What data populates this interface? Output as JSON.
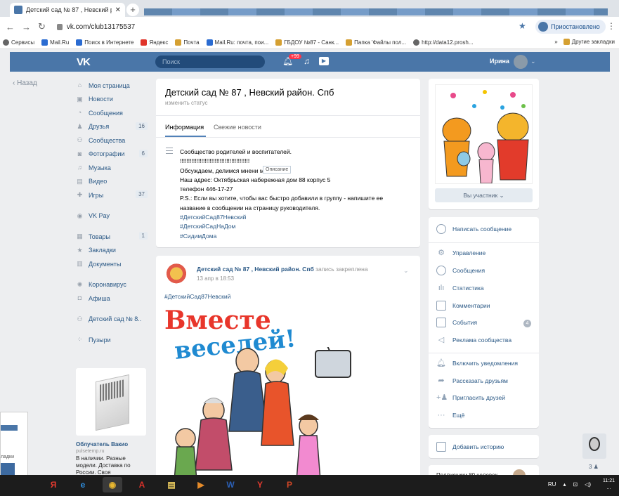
{
  "browser": {
    "tab_title": "Детский сад № 87 , Невский р",
    "url": "vk.com/club13175537",
    "profile_label": "Приостановлено",
    "bookmarks": [
      {
        "label": "Сервисы",
        "color": "grey"
      },
      {
        "label": "Mail.Ru",
        "color": "blue"
      },
      {
        "label": "Поиск в Интернете",
        "color": "blue"
      },
      {
        "label": "Яндекс",
        "color": "red"
      },
      {
        "label": "Почта",
        "color": "yellow"
      },
      {
        "label": "Mail.Ru: почта, пои...",
        "color": "blue"
      },
      {
        "label": "ГБДОУ №87 - Санк...",
        "color": "yellow"
      },
      {
        "label": "Папка 'Файлы пол...",
        "color": "yellow"
      },
      {
        "label": "http://data12.prosh...",
        "color": "grey"
      }
    ],
    "more_bookmarks": "»",
    "other_bookmarks": "Другие закладки"
  },
  "vk_header": {
    "logo": "VK",
    "search_placeholder": "Поиск",
    "notifications_badge": "+99",
    "user_name": "Ирина"
  },
  "back_label": "Назад",
  "sidebar": {
    "items": [
      {
        "label": "Моя страница",
        "icon": "home-icon",
        "glyph": "⌂",
        "count": ""
      },
      {
        "label": "Новости",
        "icon": "news-icon",
        "glyph": "▣",
        "count": ""
      },
      {
        "label": "Сообщения",
        "icon": "messages-icon",
        "glyph": "◔",
        "count": ""
      },
      {
        "label": "Друзья",
        "icon": "friends-icon",
        "glyph": "♟",
        "count": "16"
      },
      {
        "label": "Сообщества",
        "icon": "communities-icon",
        "glyph": "⚇",
        "count": ""
      },
      {
        "label": "Фотографии",
        "icon": "photos-icon",
        "glyph": "◙",
        "count": "6"
      },
      {
        "label": "Музыка",
        "icon": "music-icon",
        "glyph": "♫",
        "count": ""
      },
      {
        "label": "Видео",
        "icon": "video-icon",
        "glyph": "▤",
        "count": ""
      },
      {
        "label": "Игры",
        "icon": "games-icon",
        "glyph": "✚",
        "count": "37"
      }
    ],
    "vkpay": {
      "label": "VK Pay",
      "icon": "vkpay-icon",
      "glyph": "◉"
    },
    "items2": [
      {
        "label": "Товары",
        "icon": "goods-icon",
        "glyph": "▦",
        "count": "1"
      },
      {
        "label": "Закладки",
        "icon": "bookmarks-icon",
        "glyph": "★",
        "count": ""
      },
      {
        "label": "Документы",
        "icon": "documents-icon",
        "glyph": "▥",
        "count": ""
      }
    ],
    "items3": [
      {
        "label": "Коронавирус",
        "icon": "coronavirus-icon",
        "glyph": "✺",
        "count": ""
      },
      {
        "label": "Афиша",
        "icon": "events-icon",
        "glyph": "◘",
        "count": ""
      }
    ],
    "community_link": {
      "label": "Детский сад № 8..",
      "icon": "community-icon",
      "glyph": "⚇"
    },
    "bubbles": {
      "label": "Пузыри",
      "icon": "bubbles-icon",
      "glyph": "⁘"
    }
  },
  "ad": {
    "title": "Облучатель Вакио",
    "source": "pulsetemp.ru",
    "description": "В наличии. Разные модели. Доставка по России. Своя"
  },
  "mini_window": {
    "label": "ладки"
  },
  "group": {
    "title": "Детский сад № 87 , Невский район. Спб",
    "status": "изменить статус",
    "tabs": [
      "Информация",
      "Свежие новости"
    ],
    "info_lines": [
      "Сообщество родителей и воспитателей.",
      "!!!!!!!!!!!!!!!!!!!!!!!!!!!!!!!!!!!!!!!!!!",
      "Обсуждаем, делимся мнени         м.",
      "Наш адрес: Октябрьская набережная дом 88 корпус 5",
      "телефон 446-17-27",
      "P.S.: Если вы хотите, чтобы вас быстро добавили в группу - напишите ее",
      "название в сообщении на страницу руководителя."
    ],
    "hashtags": [
      "#ДетскийСад87Невский",
      "#ДетскийСадНаДом",
      "#СидимДома"
    ],
    "tooltip": "Описание"
  },
  "post": {
    "author": "Детский сад № 87 , Невский район. Спб",
    "pinned_note": "запись закреплена",
    "date": "13 апр в 18:53",
    "hashtag": "#ДетскийСад87Невский",
    "image_text_line1": "Вместе",
    "image_text_line2": "веселей!"
  },
  "right": {
    "member_button": "Вы участник ⌄",
    "actions": [
      {
        "label": "Написать сообщение",
        "icon": "message-icon"
      },
      {
        "label": "Управление",
        "icon": "settings-icon"
      },
      {
        "label": "Сообщения",
        "icon": "chat-icon"
      },
      {
        "label": "Статистика",
        "icon": "stats-icon"
      },
      {
        "label": "Комментарии",
        "icon": "comments-icon"
      },
      {
        "label": "События",
        "icon": "events-icon"
      },
      {
        "label": "Реклама сообщества",
        "icon": "ads-icon"
      },
      {
        "label": "Включить уведомления",
        "icon": "bell-icon"
      },
      {
        "label": "Рассказать друзьям",
        "icon": "share-icon"
      },
      {
        "label": "Пригласить друзей",
        "icon": "invite-icon"
      },
      {
        "label": "Ещё",
        "icon": "more-icon"
      }
    ],
    "events_count": "4",
    "story_button": "Добавить историю",
    "members_label": "Подписчики 80 человек",
    "chat_counter": "3"
  },
  "taskbar": {
    "apps": [
      {
        "icon": "yandex-icon",
        "glyph": "Я",
        "color": "#e23a2f"
      },
      {
        "icon": "ie-icon",
        "glyph": "e",
        "color": "#2f8fdf"
      },
      {
        "icon": "chrome-icon",
        "glyph": "◉",
        "color": "#e8b730"
      },
      {
        "icon": "acrobat-icon",
        "glyph": "A",
        "color": "#d8322a"
      },
      {
        "icon": "notes-icon",
        "glyph": "▤",
        "color": "#f0d060"
      },
      {
        "icon": "media-icon",
        "glyph": "▶",
        "color": "#e58b2a"
      },
      {
        "icon": "word-icon",
        "glyph": "W",
        "color": "#2b5fb4"
      },
      {
        "icon": "yandex-browser-icon",
        "glyph": "Y",
        "color": "#e23a2f"
      },
      {
        "icon": "powerpoint-icon",
        "glyph": "P",
        "color": "#d24726"
      }
    ],
    "lang": "RU",
    "time": "11:21",
    "date": "..."
  }
}
